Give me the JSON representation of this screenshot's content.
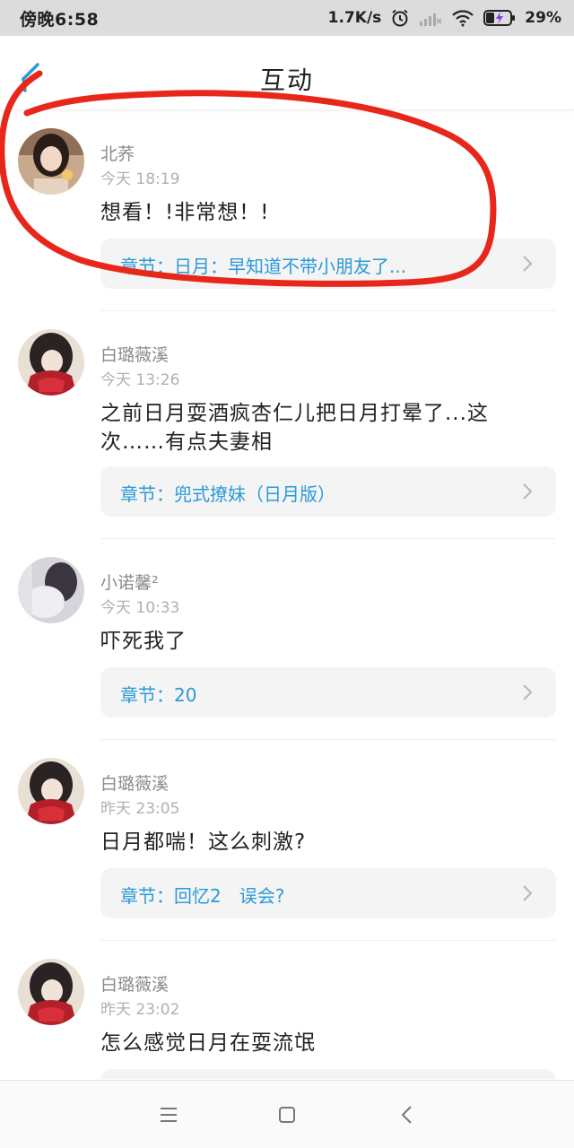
{
  "status_bar": {
    "time": "傍晚6:58",
    "net_speed": "1.7K/s",
    "battery": "29%"
  },
  "header": {
    "title": "互动"
  },
  "comments": [
    {
      "username": "北荞",
      "time": "今天 18:19",
      "text": "想看！!非常想！!",
      "chapter": "章节：日月：早知道不带小朋友了..."
    },
    {
      "username": "白璐薇溪",
      "time": "今天 13:26",
      "text": "之前日月耍酒疯杏仁儿把日月打晕了...这次……有点夫妻相",
      "chapter": "章节：兜式撩妹（日月版）"
    },
    {
      "username": "小诺馨²",
      "time": "今天 10:33",
      "text": "吓死我了",
      "chapter": "章节：20"
    },
    {
      "username": "白璐薇溪",
      "time": "昨天 23:05",
      "text": "日月都喘！这么刺激?",
      "chapter": "章节：回忆2　误会?"
    },
    {
      "username": "白璐薇溪",
      "time": "昨天 23:02",
      "text": "怎么感觉日月在耍流氓",
      "chapter": ""
    }
  ],
  "colors": {
    "accent": "#2a9ad8",
    "annotation": "#e8271b",
    "status_bar_bg": "#dcdcdc"
  },
  "icons": {
    "back": "back-arrow-icon",
    "chevron": "chevron-right-icon",
    "nav_menu": "menu-icon",
    "nav_home": "home-square-icon",
    "nav_back": "nav-back-icon"
  }
}
